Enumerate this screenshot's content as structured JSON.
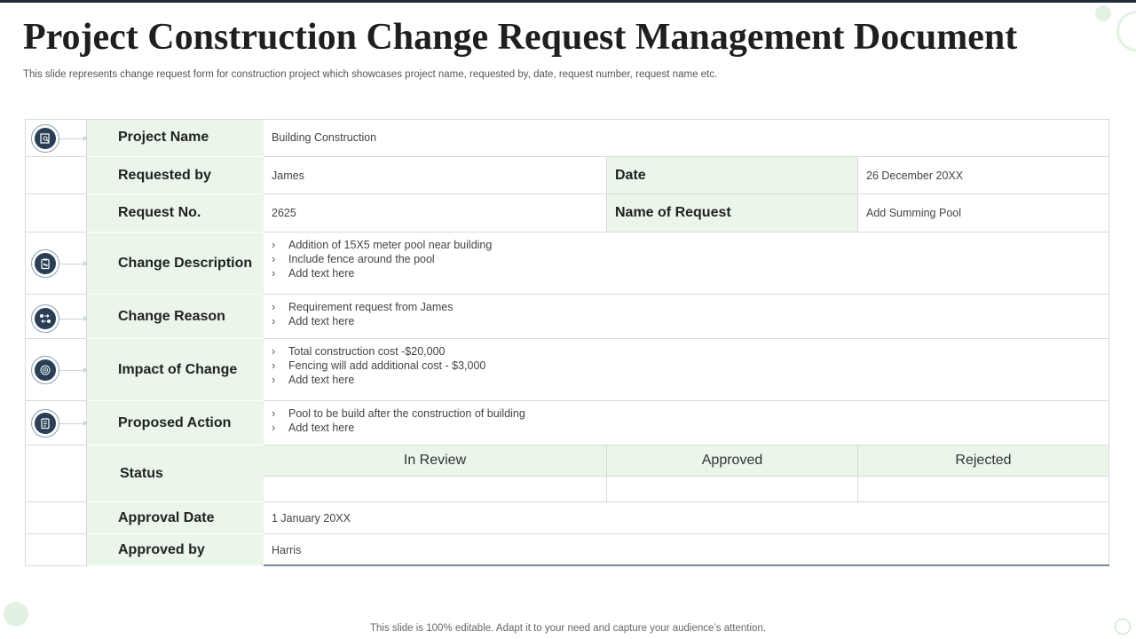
{
  "title": "Project Construction Change Request Management Document",
  "subtitle": "This slide represents change request form for construction project which showcases project name, requested by, date, request number, request name etc.",
  "footer": "This slide is 100% editable. Adapt it to your need and capture your audience’s attention.",
  "form": {
    "project_name": {
      "label": "Project Name",
      "value": "Building Construction"
    },
    "requested_by": {
      "label": "Requested by",
      "value": "James"
    },
    "date": {
      "label": "Date",
      "value": "26 December 20XX"
    },
    "request_no": {
      "label": "Request No.",
      "value": "2625"
    },
    "name_of_request": {
      "label": "Name of Request",
      "value": "Add Summing Pool"
    },
    "change_description": {
      "label": "Change Description",
      "items": [
        "Addition of 15X5  meter pool near building",
        "Include fence around the pool",
        "Add text here"
      ]
    },
    "change_reason": {
      "label": "Change Reason",
      "items": [
        "Requirement  request from James",
        "Add text here"
      ]
    },
    "impact_of_change": {
      "label": "Impact of Change",
      "items": [
        "Total construction cost -$20,000",
        "Fencing will add additional cost - $3,000",
        "Add text here"
      ]
    },
    "proposed_action": {
      "label": "Proposed Action",
      "items": [
        "Pool to be build after the construction of building",
        "Add text here"
      ]
    },
    "status": {
      "label": "Status",
      "options": [
        "In Review",
        "Approved",
        "Rejected"
      ]
    },
    "approval_date": {
      "label": "Approval Date",
      "value": "1 January  20XX"
    },
    "approved_by": {
      "label": "Approved by",
      "value": "Harris"
    }
  },
  "icons": [
    "document-search-icon",
    "clipboard-icon",
    "people-exchange-icon",
    "target-icon",
    "checklist-icon"
  ],
  "colors": {
    "label_bg": "#e9f6e9",
    "icon_bg": "#2a3f56",
    "accent": "#1f2d3a"
  }
}
